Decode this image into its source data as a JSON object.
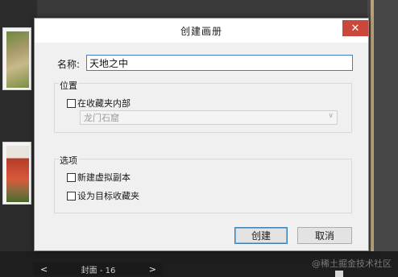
{
  "dialog": {
    "title": "创建画册",
    "close_glyph": "✕",
    "name_label": "名称:",
    "name_value": "天地之中",
    "location": {
      "group_title": "位置",
      "in_folder_label": "在收藏夹内部",
      "in_folder_checked": false,
      "folder_select_value": "龙门石窟",
      "folder_select_disabled": true
    },
    "options": {
      "group_title": "选项",
      "virtual_copy_label": "新建虚拟副本",
      "virtual_copy_checked": false,
      "set_target_label": "设为目标收藏夹",
      "set_target_checked": false
    },
    "buttons": {
      "create_label": "创建",
      "cancel_label": "取消"
    }
  },
  "filmstrip": {
    "prev_glyph": "<",
    "next_glyph": ">",
    "count_label": "封面 - 16"
  },
  "watermark": "@稀土掘金技术社区",
  "colors": {
    "close_button": "#c9483b",
    "input_focus_border": "#3f7ec9",
    "default_button_border": "#3c7fb1"
  }
}
